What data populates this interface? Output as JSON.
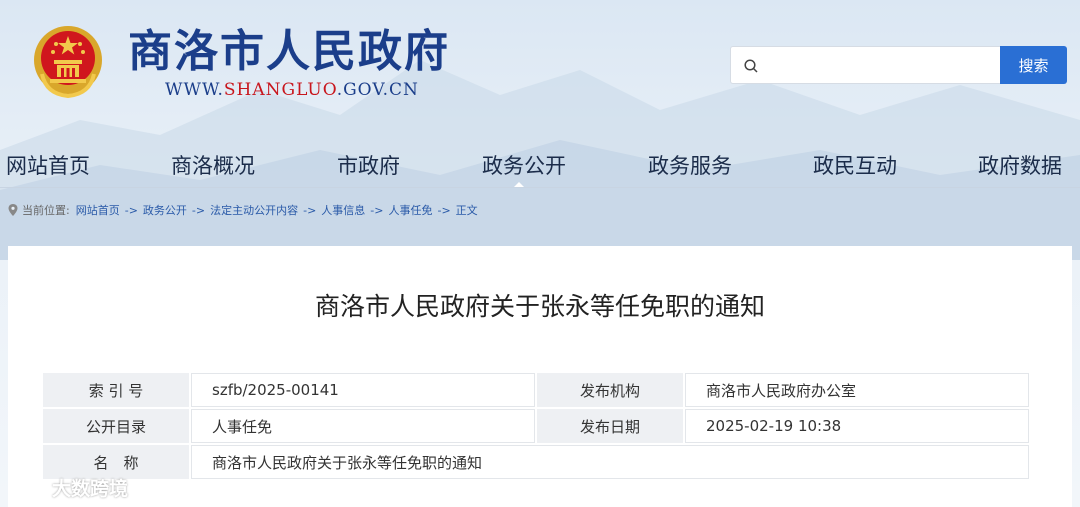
{
  "header": {
    "site_title": "商洛市人民政府",
    "url_prefix": "WWW.",
    "url_highlight": "SHANGLUO",
    "url_suffix": ".GOV.CN",
    "search_placeholder": "",
    "search_button": "搜索"
  },
  "nav": {
    "items": [
      "网站首页",
      "商洛概况",
      "市政府",
      "政务公开",
      "政务服务",
      "政民互动",
      "政府数据"
    ],
    "active": "政务公开"
  },
  "breadcrumb": {
    "prefix": "当前位置:",
    "items": [
      "网站首页",
      "政务公开",
      "法定主动公开内容",
      "人事信息",
      "人事任免",
      "正文"
    ],
    "separator": "->"
  },
  "document": {
    "title": "商洛市人民政府关于张永等任免职的通知",
    "meta": {
      "index_label": "索 引 号",
      "index_value": "szfb/2025-00141",
      "publisher_label": "发布机构",
      "publisher_value": "商洛市人民政府办公室",
      "catalog_label": "公开目录",
      "catalog_value": "人事任免",
      "date_label": "发布日期",
      "date_value": "2025-02-19 10:38",
      "name_label": "名　称",
      "name_value": "商洛市人民政府关于张永等任免职的通知"
    }
  },
  "watermark": "大数跨境",
  "colors": {
    "brand_blue": "#1b3e8a",
    "url_red": "#c8161d",
    "search_button": "#2a6fd4",
    "link_blue": "#2a5aa8"
  }
}
